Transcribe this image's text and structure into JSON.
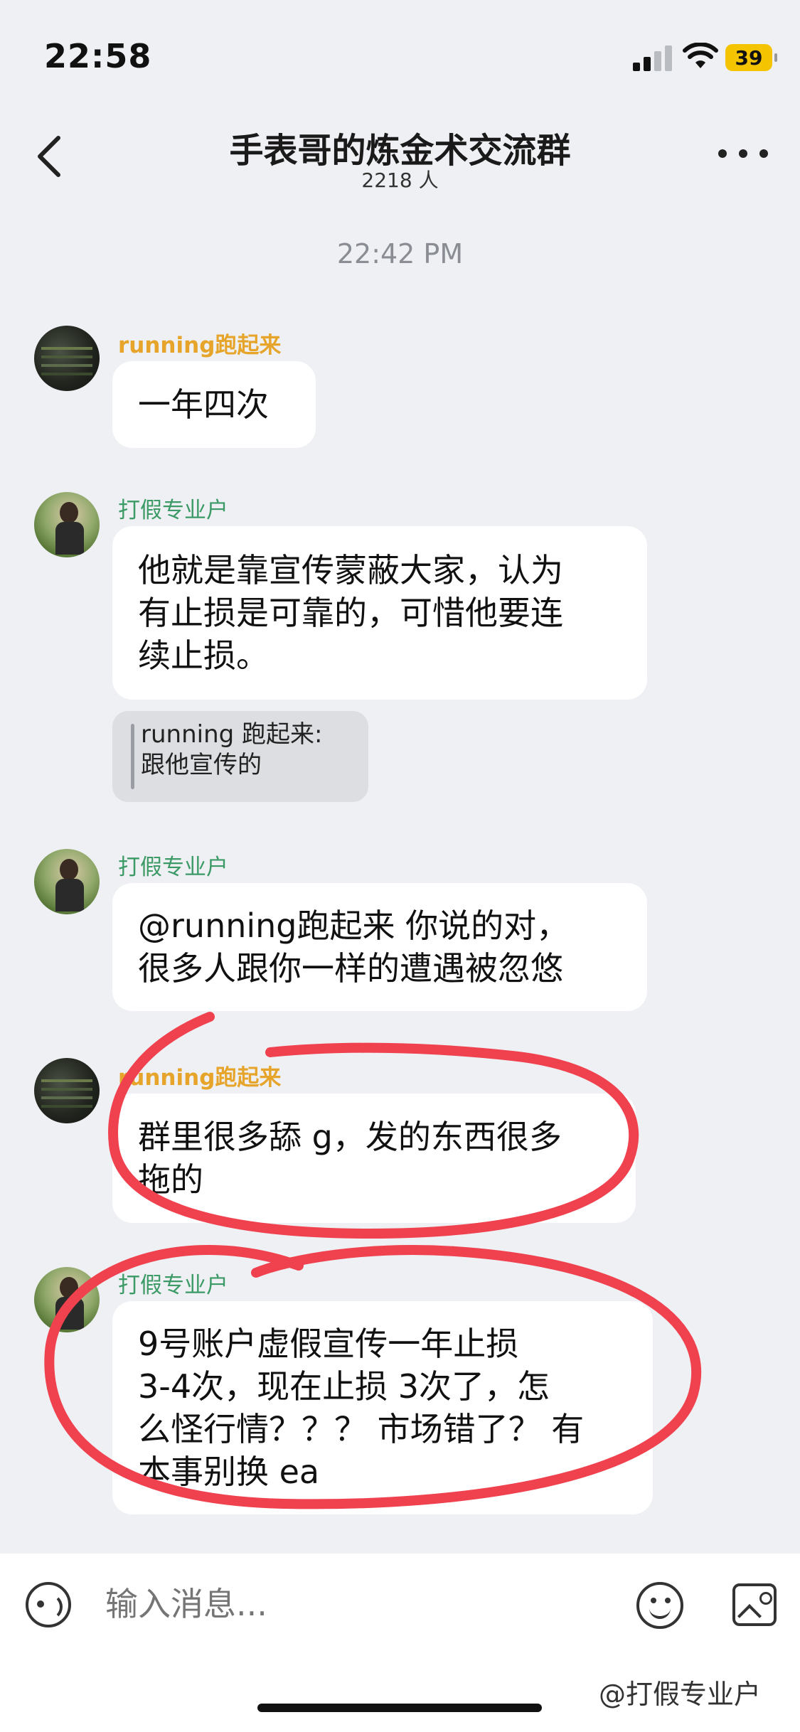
{
  "status_bar": {
    "time": "22:58",
    "battery": "39"
  },
  "header": {
    "title": "手表哥的炼金术交流群",
    "members": "2218 人"
  },
  "timestamp": "22:42 PM",
  "messages": [
    {
      "sender": "running跑起来",
      "text": "一年四次"
    },
    {
      "sender": "打假专业户",
      "text_lines": [
        "他就是靠宣传蒙蔽大家，认为",
        "有止损是可靠的，可惜他要连",
        "续止损。"
      ]
    },
    {
      "quote_lines": [
        "running 跑起来:",
        "跟他宣传的"
      ]
    },
    {
      "sender": "打假专业户",
      "text_lines": [
        "@running跑起来 你说的对，",
        "很多人跟你一样的遭遇被忽悠"
      ]
    },
    {
      "sender": "running跑起来",
      "text_lines": [
        "群里很多舔 g，发的东西很多",
        "拖的"
      ]
    },
    {
      "sender": "打假专业户",
      "text_lines": [
        "9号账户虚假宣传一年止损",
        " 3-4次，现在止损 3次了，怎",
        "么怪行情？？？  市场错了？ 有",
        "本事别换 ea"
      ]
    }
  ],
  "input": {
    "placeholder": "输入消息..."
  },
  "watermark": "@打假专业户",
  "colors": {
    "background": "#eef0f3",
    "name_yellow": "#e6a52a",
    "name_green": "#3c9a66",
    "annotation_red": "#f0414f"
  }
}
